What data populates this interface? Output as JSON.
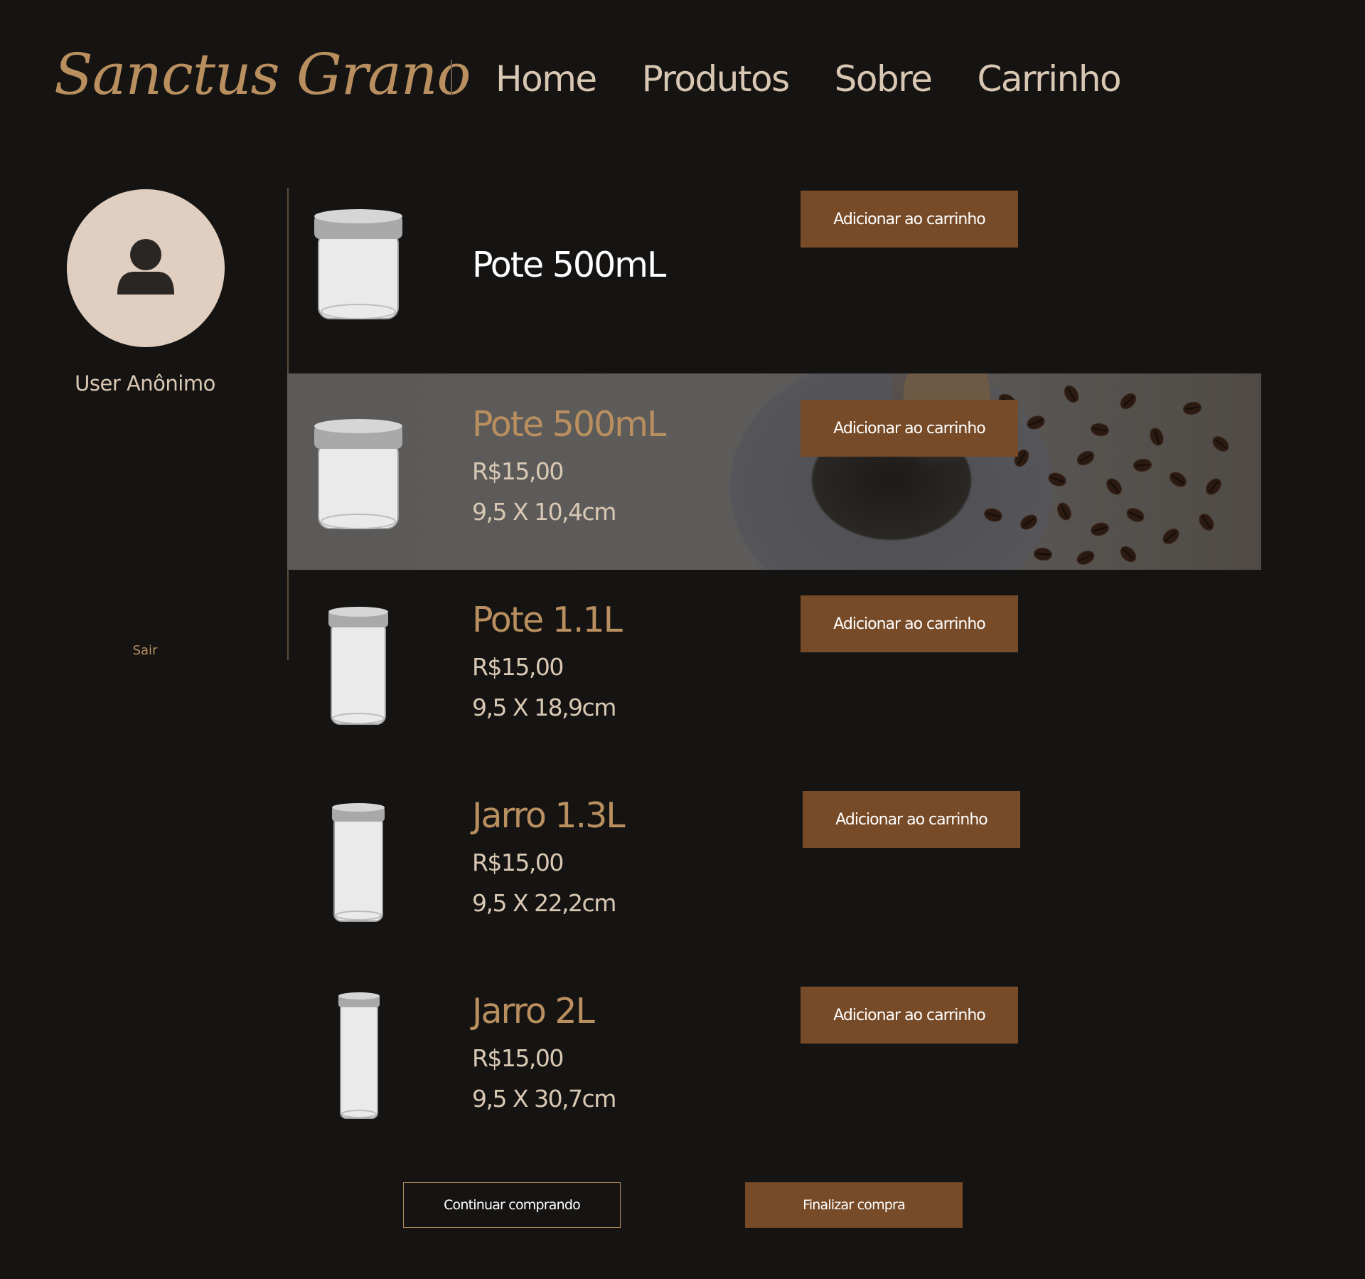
{
  "brand": {
    "logo_text": "Sanctus Grano"
  },
  "nav": {
    "items": [
      "Home",
      "Produtos",
      "Sobre",
      "Carrinho"
    ]
  },
  "sidebar": {
    "avatar_icon": "user-icon",
    "username": "User Anônimo",
    "logout_label": "Sair"
  },
  "products": [
    {
      "name": "Pote 500mL",
      "add_label": "Adicionar ao carrinho"
    },
    {
      "name": "Pote 500mL",
      "price": "R$15,00",
      "dims": "9,5 X 10,4cm",
      "add_label": "Adicionar ao carrinho"
    },
    {
      "name": "Pote 1.1L",
      "price": "R$15,00",
      "dims": "9,5 X 18,9cm",
      "add_label": "Adicionar ao carrinho"
    },
    {
      "name": "Jarro 1.3L",
      "price": "R$15,00",
      "dims": "9,5 X 22,2cm",
      "add_label": "Adicionar ao carrinho"
    },
    {
      "name": "Jarro 2L",
      "price": "R$15,00",
      "dims": "9,5 X 30,7cm",
      "add_label": "Adicionar ao carrinho"
    }
  ],
  "actions": {
    "continue_label": "Continuar comprando",
    "checkout_label": "Finalizar compra"
  },
  "colors": {
    "background": "#161412",
    "accent_gold": "#b98f5f",
    "button_brown": "#774b28",
    "text_light": "#d9c8b4"
  }
}
